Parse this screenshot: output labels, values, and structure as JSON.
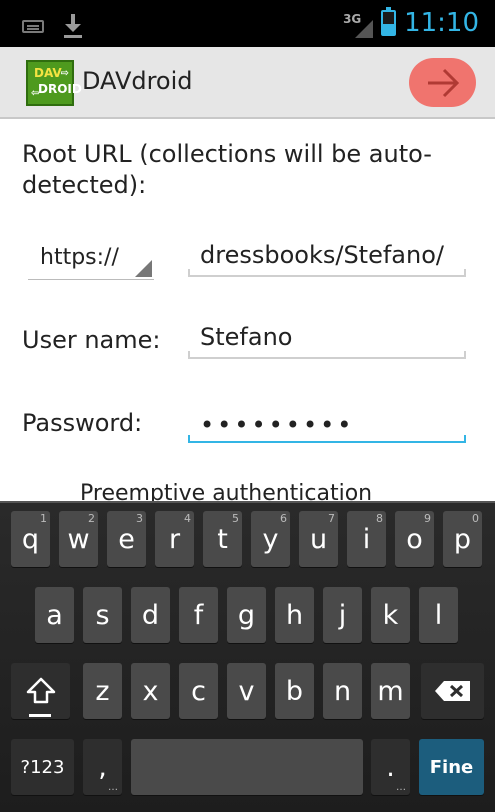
{
  "status_bar": {
    "network": "3G",
    "time": "11:10"
  },
  "action_bar": {
    "logo_line1": "DAV",
    "logo_line2": "DROID",
    "title": "DAVdroid",
    "next_icon": "arrow-right-icon"
  },
  "form": {
    "description": "Root URL (collections will be auto-detected):",
    "scheme_selected": "https://",
    "url_value": "dressbooks/Stefano/",
    "username_label": "User name:",
    "username_value": "Stefano",
    "password_label": "Password:",
    "password_value": "•••••••••",
    "preemptive_label": "Preemptive authentication"
  },
  "keyboard": {
    "row1": [
      "q",
      "w",
      "e",
      "r",
      "t",
      "y",
      "u",
      "i",
      "o",
      "p"
    ],
    "row1_hints": [
      "1",
      "2",
      "3",
      "4",
      "5",
      "6",
      "7",
      "8",
      "9",
      "0"
    ],
    "row2": [
      "a",
      "s",
      "d",
      "f",
      "g",
      "h",
      "j",
      "k",
      "l"
    ],
    "row3": [
      "z",
      "x",
      "c",
      "v",
      "b",
      "n",
      "m"
    ],
    "symbols_label": "?123",
    "comma_label": ",",
    "period_label": ".",
    "action_label": "Fine",
    "shift_icon": "shift-icon",
    "backspace_icon": "backspace-icon"
  },
  "colors": {
    "accent": "#33b5e5",
    "next_button": "#f0746e",
    "logo_green": "#4e9a1e",
    "action_key": "#1c5d7d"
  }
}
